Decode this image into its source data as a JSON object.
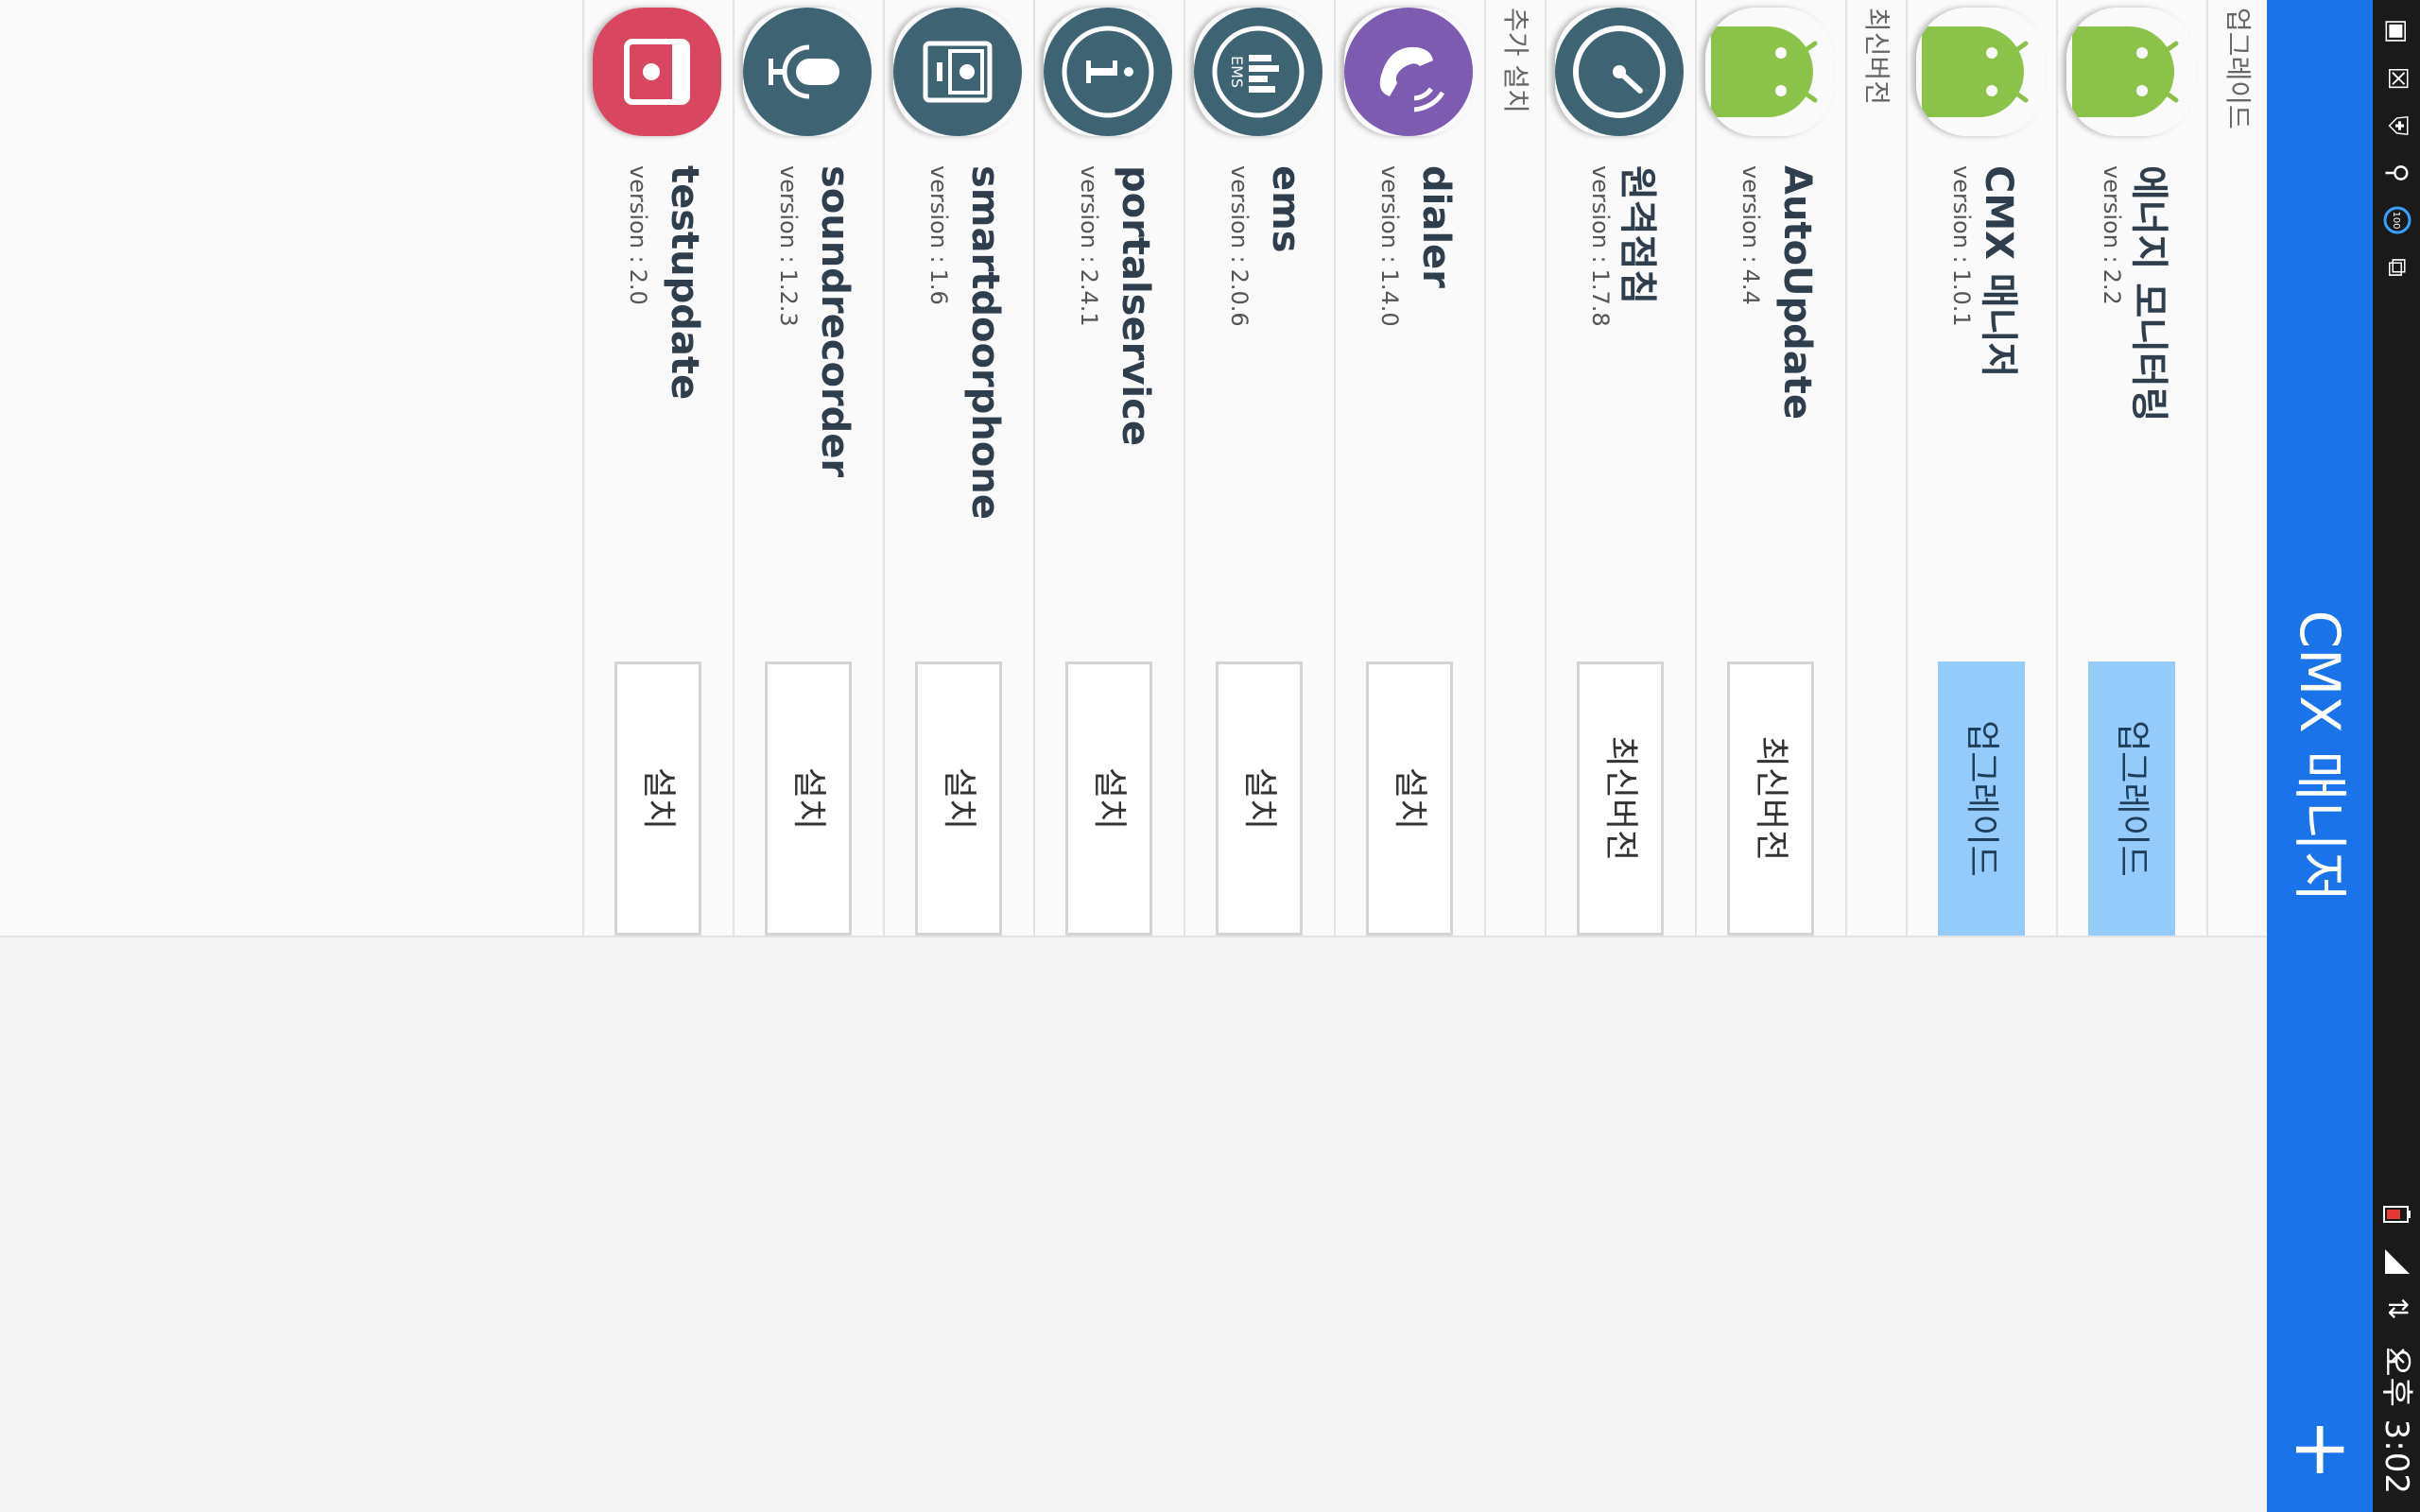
{
  "statusbar": {
    "time": "오후 3:02",
    "battery": "100"
  },
  "appbar": {
    "title": "CMX 매니저",
    "add_label": "+"
  },
  "sections": [
    {
      "header": "업그레이드",
      "items": [
        {
          "name": "에너지 모니터링",
          "version_label": "version :",
          "version": "2.2",
          "button": "업그레이드",
          "icon": "android-icon"
        },
        {
          "name": "CMX 매니저",
          "version_label": "version :",
          "version": "1.0.1",
          "button": "업그레이드",
          "icon": "android-icon"
        }
      ]
    },
    {
      "header": "최신버전",
      "items": [
        {
          "name": "AutoUpdate",
          "version_label": "version :",
          "version": "4.4",
          "button": "최신버전",
          "icon": "android-icon"
        },
        {
          "name": "원격점침",
          "version_label": "version :",
          "version": "1.7.8",
          "button": "최신버전",
          "icon": "gauge-icon"
        }
      ]
    },
    {
      "header": "추가 설치",
      "items": [
        {
          "name": "dialer",
          "version_label": "version :",
          "version": "1.4.0",
          "button": "설치",
          "icon": "phone-icon"
        },
        {
          "name": "ems",
          "version_label": "version :",
          "version": "2.0.6",
          "button": "설치",
          "icon": "ems-icon",
          "icon_text": "EMS"
        },
        {
          "name": "portalservice",
          "version_label": "version :",
          "version": "2.4.1",
          "button": "설치",
          "icon": "info-icon"
        },
        {
          "name": "smartdoorphone",
          "version_label": "version :",
          "version": "1.6",
          "button": "설치",
          "icon": "doorphone-icon"
        },
        {
          "name": "soundrecorder",
          "version_label": "version :",
          "version": "1.2.3",
          "button": "설치",
          "icon": "microphone-icon"
        },
        {
          "name": "testupdate",
          "version_label": "version :",
          "version": "2.0",
          "button": "설치",
          "icon": "package-icon"
        }
      ]
    }
  ],
  "colors": {
    "appbar": "#1a73e8",
    "primary_button": "#95cbfa",
    "android_green": "#8bc34a",
    "icon_teal": "#3e6474",
    "icon_purple": "#7c5bb0",
    "icon_red": "#d9465f"
  }
}
